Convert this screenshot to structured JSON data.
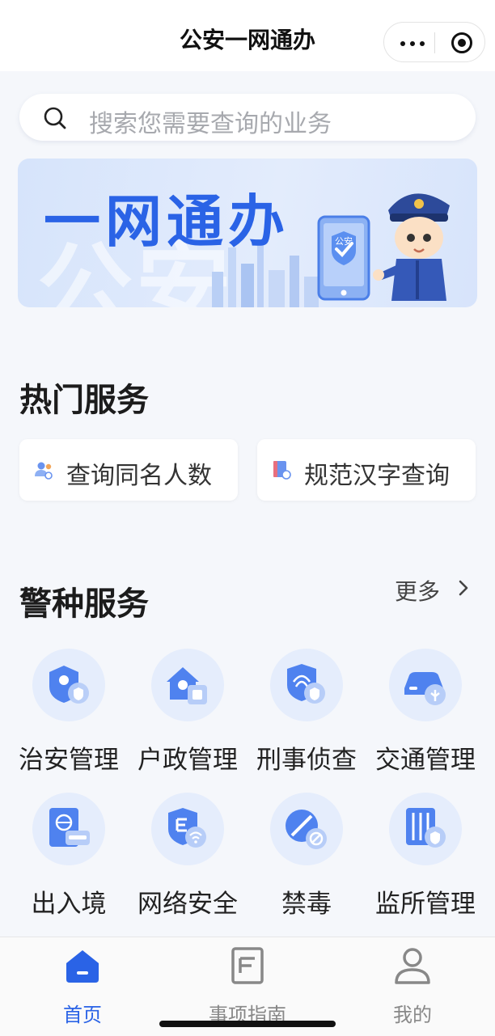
{
  "nav": {
    "title": "公安一网通办"
  },
  "search": {
    "placeholder": "搜索您需要查询的业务"
  },
  "banner": {
    "title": "一网通办",
    "bg_text": "公安",
    "badge": "公安"
  },
  "hot": {
    "title": "热门服务",
    "items": [
      {
        "label": "查询同名人数",
        "icon": "people-search-icon"
      },
      {
        "label": "规范汉字查询",
        "icon": "dictionary-icon"
      }
    ]
  },
  "police": {
    "title": "警种服务",
    "more": "更多",
    "items": [
      {
        "label": "治安管理",
        "icon": "public-security-icon"
      },
      {
        "label": "户政管理",
        "icon": "household-icon"
      },
      {
        "label": "刑事侦查",
        "icon": "fingerprint-icon"
      },
      {
        "label": "交通管理",
        "icon": "car-icon"
      },
      {
        "label": "出入境",
        "icon": "passport-icon"
      },
      {
        "label": "网络安全",
        "icon": "network-security-icon"
      },
      {
        "label": "禁毒",
        "icon": "anti-drug-icon"
      },
      {
        "label": "监所管理",
        "icon": "prison-icon"
      }
    ]
  },
  "tabbar": [
    {
      "label": "首页",
      "icon": "home-icon",
      "active": true
    },
    {
      "label": "事项指南",
      "icon": "document-icon",
      "active": false
    },
    {
      "label": "我的",
      "icon": "user-icon",
      "active": false
    }
  ],
  "colors": {
    "accent": "#2a63e6",
    "icon_bg": "#e5edfc"
  }
}
